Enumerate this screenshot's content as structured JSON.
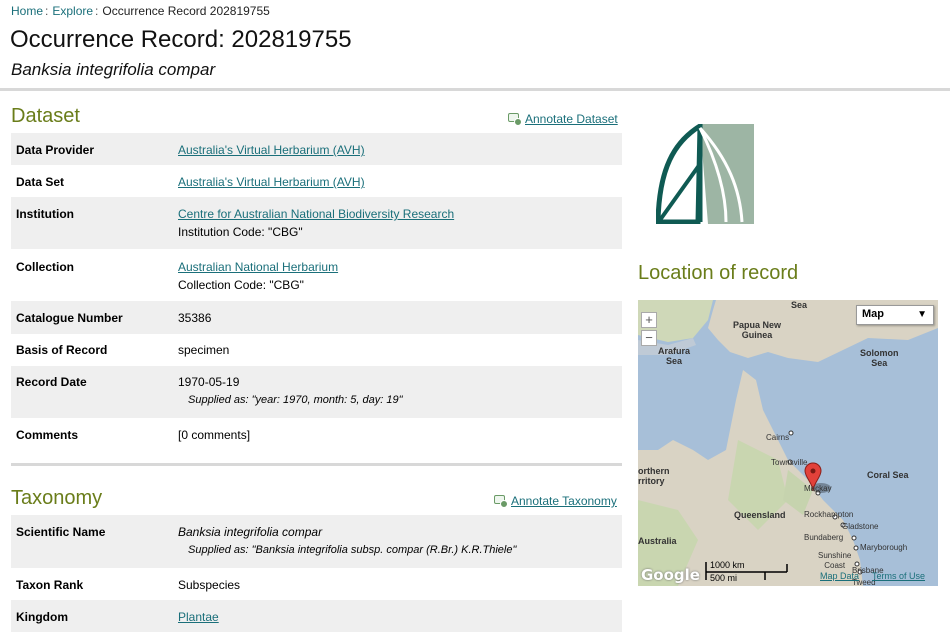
{
  "breadcrumb": {
    "home": "Home",
    "explore": "Explore",
    "current": "Occurrence Record 202819755",
    "sep": ":"
  },
  "page": {
    "title": "Occurrence Record: 202819755",
    "subtitle": "Banksia integrifolia compar"
  },
  "dataset": {
    "heading": "Dataset",
    "annotate": "Annotate Dataset",
    "rows": {
      "provider": {
        "label": "Data Provider",
        "value": "Australia's Virtual Herbarium (AVH)"
      },
      "dataset": {
        "label": "Data Set",
        "value": "Australia's Virtual Herbarium (AVH)"
      },
      "institution": {
        "label": "Institution",
        "value": "Centre for Australian National Biodiversity Research",
        "code": "Institution Code: \"CBG\""
      },
      "collection": {
        "label": "Collection",
        "value": "Australian National Herbarium",
        "code": "Collection Code: \"CBG\""
      },
      "catalogue": {
        "label": "Catalogue Number",
        "value": "35386"
      },
      "basis": {
        "label": "Basis of Record",
        "value": "specimen"
      },
      "date": {
        "label": "Record Date",
        "value": "1970-05-19",
        "supplied": "Supplied as: \"year: 1970, month: 5, day: 19\""
      },
      "comments": {
        "label": "Comments",
        "value": "[0 comments]"
      }
    }
  },
  "taxonomy": {
    "heading": "Taxonomy",
    "annotate": "Annotate Taxonomy",
    "rows": {
      "sciname": {
        "label": "Scientific Name",
        "value": "Banksia integrifolia compar",
        "supplied": "Supplied as: \"Banksia integrifolia subsp. compar (R.Br.) K.R.Thiele\""
      },
      "rank": {
        "label": "Taxon Rank",
        "value": "Subspecies"
      },
      "kingdom": {
        "label": "Kingdom",
        "value": "Plantae"
      }
    }
  },
  "location": {
    "heading": "Location of record",
    "map_type": "Map",
    "zoom_in": "+",
    "zoom_out": "−",
    "labels": {
      "sea": "Sea",
      "png": "Papua New\nGuinea",
      "arafura": "Arafura\nSea",
      "solomon": "Solomon\nSea",
      "cairns": "Cairns",
      "townsville": "Townsville",
      "mackay": "Mackay",
      "coral": "Coral Sea",
      "northern": "orthern\nrritory",
      "queensland": "Queensland",
      "rockhampton": "Rockhampton",
      "gladstone": "Gladstone",
      "bundaberg": "Bundaberg",
      "maryborough": "Maryborough",
      "australia": "Australia",
      "sunshine": "Sunshine\nCoast",
      "brisbane": "Brisbane",
      "tweed": "Tweed"
    },
    "scale_km": "1000 km",
    "scale_mi": "500 mi",
    "google": "Google",
    "map_data": "Map Data",
    "terms": "Terms of Use"
  },
  "colors": {
    "heading": "#6a7d1a",
    "link": "#1a6f7a",
    "logo_dark": "#0f5a53",
    "logo_light": "#9db5a4"
  }
}
